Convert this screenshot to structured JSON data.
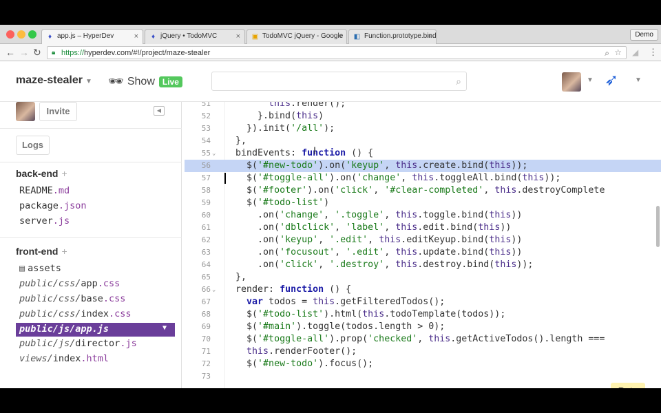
{
  "browser": {
    "tabs": [
      {
        "label": "app.js – HyperDev",
        "icon": "hyperdev-icon"
      },
      {
        "label": "jQuery • TodoMVC",
        "icon": "hyperdev-icon"
      },
      {
        "label": "TodoMVC jQuery - Google",
        "icon": "drive-icon"
      },
      {
        "label": "Function.prototype.bind()",
        "icon": "mdn-icon"
      }
    ],
    "profile": "Demo",
    "url_scheme": "https://",
    "url_rest": "hyperdev.com/#!/project/maze-stealer"
  },
  "header": {
    "project": "maze-stealer",
    "show": "Show",
    "live": "Live",
    "search_placeholder": ""
  },
  "sidebar": {
    "invite": "Invite",
    "logs": "Logs",
    "backend_title": "back-end",
    "backend_files": [
      {
        "base": "README",
        "ext": ".md"
      },
      {
        "base": "package",
        "ext": ".json"
      },
      {
        "base": "server",
        "ext": ".js"
      }
    ],
    "frontend_title": "front-end",
    "assets": "assets",
    "frontend_files": [
      {
        "dir": "public/css/",
        "base": "app",
        "ext": ".css"
      },
      {
        "dir": "public/css/",
        "base": "base",
        "ext": ".css"
      },
      {
        "dir": "public/css/",
        "base": "index",
        "ext": ".css"
      },
      {
        "dir": "public/js/",
        "base": "app",
        "ext": ".js",
        "selected": true
      },
      {
        "dir": "public/js/",
        "base": "director",
        "ext": ".js"
      },
      {
        "dir": "views/",
        "base": "index",
        "ext": ".html"
      }
    ]
  },
  "editor": {
    "lines": [
      {
        "n": "51",
        "code": "        this.render();"
      },
      {
        "n": "52",
        "code": "      }.bind(this)"
      },
      {
        "n": "53",
        "code": "    }).init('/all');"
      },
      {
        "n": "54",
        "code": "  },"
      },
      {
        "n": "55",
        "code": "  bindEvents: function () {",
        "fold": true
      },
      {
        "n": "56",
        "code": "    $('#new-todo').on('keyup', this.create.bind(this));",
        "highlight": true
      },
      {
        "n": "57",
        "code": "    $('#toggle-all').on('change', this.toggleAll.bind(this));",
        "cursor": true
      },
      {
        "n": "58",
        "code": "    $('#footer').on('click', '#clear-completed', this.destroyComplete"
      },
      {
        "n": "59",
        "code": "    $('#todo-list')"
      },
      {
        "n": "60",
        "code": "      .on('change', '.toggle', this.toggle.bind(this))"
      },
      {
        "n": "61",
        "code": "      .on('dblclick', 'label', this.edit.bind(this))"
      },
      {
        "n": "62",
        "code": "      .on('keyup', '.edit', this.editKeyup.bind(this))"
      },
      {
        "n": "63",
        "code": "      .on('focusout', '.edit', this.update.bind(this))"
      },
      {
        "n": "64",
        "code": "      .on('click', '.destroy', this.destroy.bind(this));"
      },
      {
        "n": "65",
        "code": "  },"
      },
      {
        "n": "66",
        "code": "  render: function () {",
        "fold": true
      },
      {
        "n": "67",
        "code": "    var todos = this.getFilteredTodos();"
      },
      {
        "n": "68",
        "code": "    $('#todo-list').html(this.todoTemplate(todos));"
      },
      {
        "n": "69",
        "code": "    $('#main').toggle(todos.length > 0);"
      },
      {
        "n": "70",
        "code": "    $('#toggle-all').prop('checked', this.getActiveTodos().length ==="
      },
      {
        "n": "71",
        "code": "    this.renderFooter();"
      },
      {
        "n": "72",
        "code": "    $('#new-todo').focus();"
      },
      {
        "n": "73",
        "code": ""
      }
    ]
  },
  "beta": "Beta",
  "colors": {
    "live": "#54c85d",
    "selected": "#6a3e9a",
    "highlight": "#c5d5f5",
    "beta": "#fff3b0"
  }
}
